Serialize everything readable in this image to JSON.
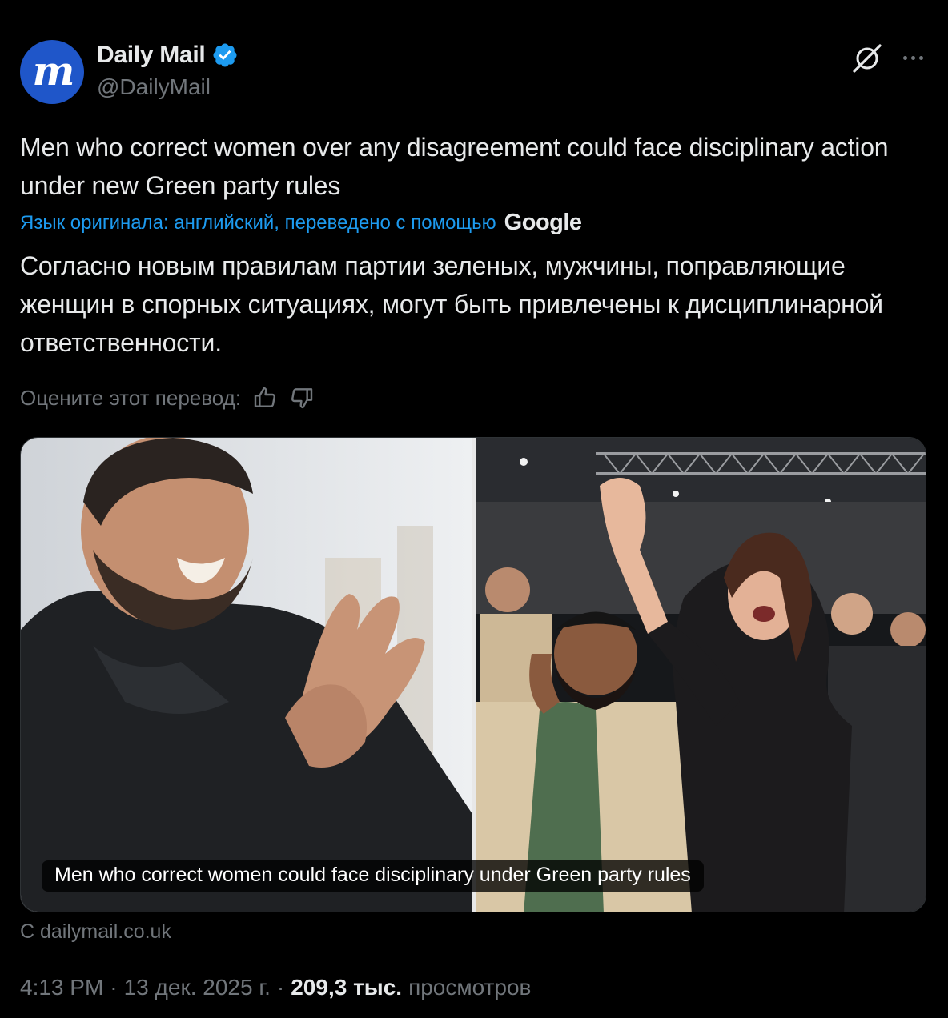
{
  "author": {
    "display_name": "Daily Mail",
    "handle": "@DailyMail",
    "avatar_icon": "daily-mail-logo",
    "verified_icon": "verified-badge-icon",
    "brand_color": "#1f56c9"
  },
  "header": {
    "grok_icon": "grok-icon",
    "more_icon": "more-options-icon"
  },
  "tweet": {
    "text_original": "Men who correct women over any disagreement could face disciplinary action under new Green party rules",
    "translation_label": "Язык оригинала: английский, переведено с помощью",
    "translation_provider": "Google",
    "text_translated": "Согласно новым правилам партии зеленых, мужчины, поправляющие женщин в спорных ситуациях, могут быть привлечены к дисциплинарной ответственности.",
    "rate_label": "Оцените этот перевод:",
    "rate_up_icon": "thumbs-up-icon",
    "rate_down_icon": "thumbs-down-icon"
  },
  "media": {
    "caption": "Men who correct women could face disciplinary under Green party rules",
    "source": "С dailymail.co.uk"
  },
  "meta": {
    "time": "4:13 PM",
    "separator": "·",
    "date": "13 дек. 2025 г.",
    "views_count": "209,3 тыс.",
    "views_label": "просмотров"
  },
  "colors": {
    "background": "#000000",
    "text_primary": "#e7e9ea",
    "text_secondary": "#71767b",
    "link": "#1d9bf0"
  }
}
